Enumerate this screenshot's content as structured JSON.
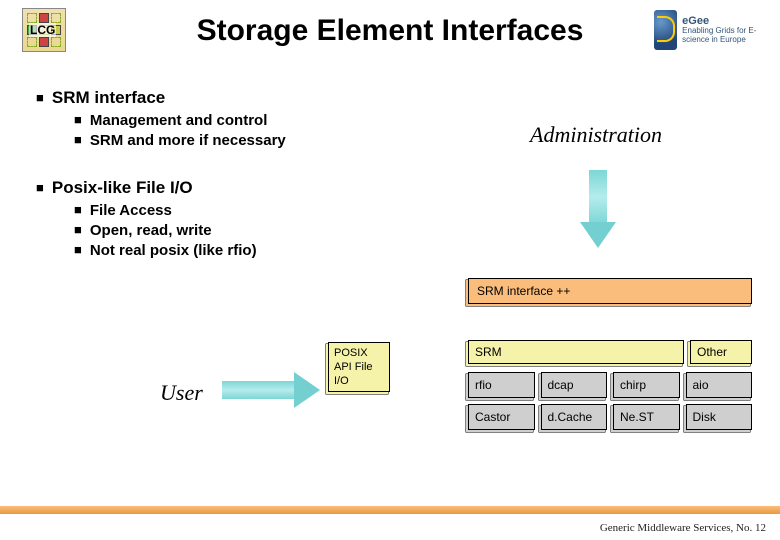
{
  "header": {
    "title": "Storage Element Interfaces",
    "lcg_label": "LCG",
    "egee_brand": "eGee",
    "egee_tagline": "Enabling Grids for E-science in Europe"
  },
  "bullets": {
    "srm": {
      "heading": "SRM interface",
      "items": [
        "Management and control",
        "SRM and more if necessary"
      ]
    },
    "posix": {
      "heading": "Posix-like File I/O",
      "items": [
        "File Access",
        "Open, read, write",
        "Not real posix (like rfio)"
      ]
    }
  },
  "labels": {
    "administration": "Administration",
    "user": "User"
  },
  "diagram": {
    "srm_bar": "SRM interface ++",
    "posix_box": "POSIX API File I/O",
    "yellow_row": {
      "srm": "SRM",
      "other": "Other"
    },
    "grid": [
      [
        "rfio",
        "dcap",
        "chirp",
        "aio"
      ],
      [
        "Castor",
        "d.Cache",
        "Ne.ST",
        "Disk"
      ]
    ]
  },
  "footer": "Generic Middleware Services, No. 12"
}
